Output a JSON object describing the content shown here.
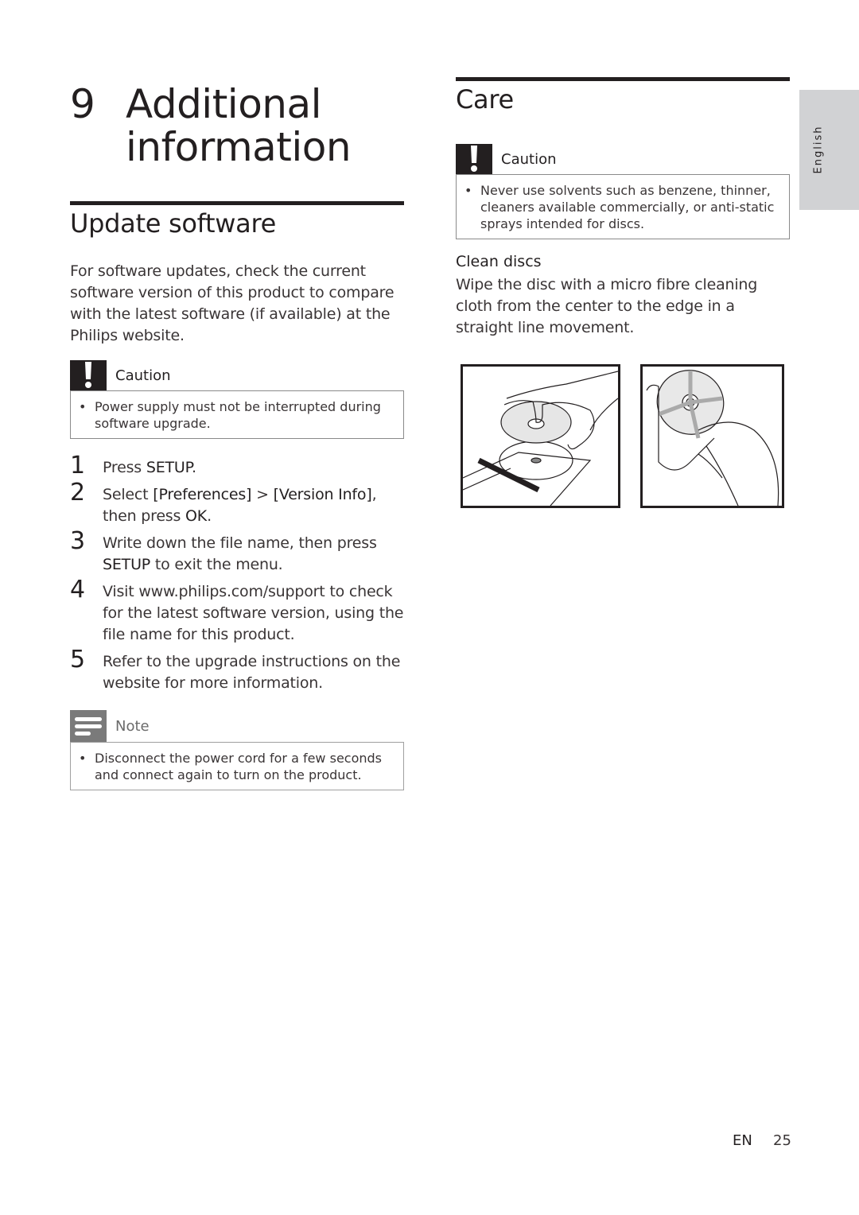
{
  "chapter": {
    "number": "9",
    "title_line1": "Additional",
    "title_line2": "information"
  },
  "update_software": {
    "title": "Update software",
    "intro": "For software updates, check the current software version of this product to compare with the latest software (if available) at the Philips website.",
    "caution": {
      "label": "Caution",
      "icon": "exclamation-icon",
      "items": [
        "Power supply must not be interrupted during software upgrade."
      ]
    },
    "steps": [
      {
        "num": "1",
        "parts": [
          "Press ",
          "SETUP",
          "."
        ]
      },
      {
        "num": "2",
        "parts": [
          "Select ",
          "[Preferences]",
          " > ",
          "[Version Info]",
          ", then press ",
          "OK",
          "."
        ]
      },
      {
        "num": "3",
        "parts": [
          "Write down the file name, then press ",
          "SETUP",
          " to exit the menu."
        ]
      },
      {
        "num": "4",
        "parts": [
          "Visit www.philips.com/support to check for the latest software version, using the file name for this product."
        ]
      },
      {
        "num": "5",
        "parts": [
          "Refer to the upgrade instructions on the website for more information."
        ]
      }
    ],
    "note": {
      "label": "Note",
      "icon": "note-lines-icon",
      "items": [
        "Disconnect the power cord for a few seconds and connect again to turn on the product."
      ]
    }
  },
  "care": {
    "title": "Care",
    "caution": {
      "label": "Caution",
      "icon": "exclamation-icon",
      "items": [
        "Never use solvents such as benzene, thinner, cleaners available commercially, or anti-static sprays intended for discs."
      ]
    },
    "clean_discs": {
      "heading": "Clean discs",
      "text": "Wipe the disc with a micro fibre cleaning cloth from the center to the edge in a straight line movement."
    },
    "illustrations": [
      "disc-handling-illustration",
      "disc-wiping-illustration"
    ]
  },
  "side_tab": {
    "label": "English"
  },
  "footer": {
    "lang": "EN",
    "page": "25"
  }
}
